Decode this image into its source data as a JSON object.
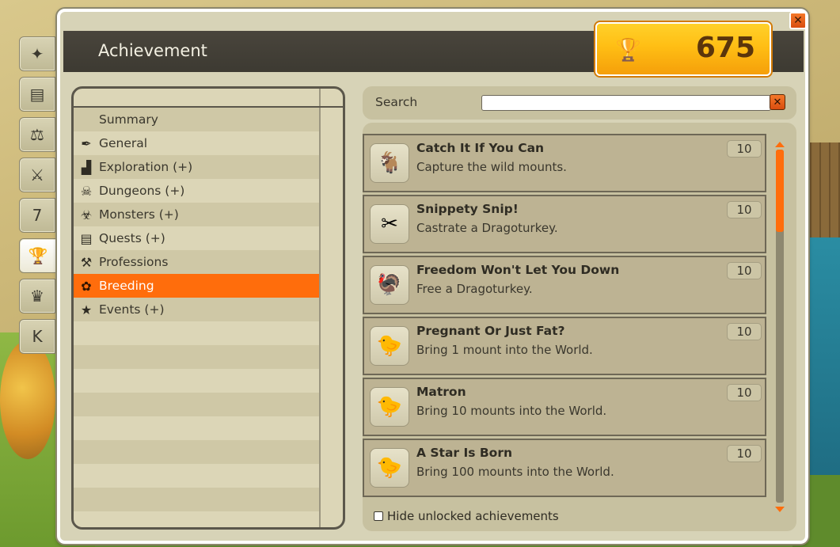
{
  "window": {
    "title": "Achievement",
    "close_label": "✕"
  },
  "score": {
    "value": "675",
    "icon": "trophy-icon"
  },
  "side_tabs": [
    {
      "icon": "wand-icon",
      "glyph": "✦"
    },
    {
      "icon": "book-icon",
      "glyph": "▤"
    },
    {
      "icon": "scales-icon",
      "glyph": "⚖"
    },
    {
      "icon": "crossed-weapons-icon",
      "glyph": "⚔"
    },
    {
      "icon": "calendar-icon",
      "glyph": "7"
    },
    {
      "icon": "trophy-icon",
      "glyph": "🏆",
      "active": true
    },
    {
      "icon": "crown-icon",
      "glyph": "♛"
    },
    {
      "icon": "k-icon",
      "glyph": "K"
    }
  ],
  "categories": [
    {
      "label": "Summary",
      "icon": "",
      "glyph": ""
    },
    {
      "label": "General",
      "icon": "quill-icon",
      "glyph": "✒"
    },
    {
      "label": "Exploration (+)",
      "icon": "boot-icon",
      "glyph": "▟"
    },
    {
      "label": "Dungeons (+)",
      "icon": "horned-skull-icon",
      "glyph": "☠"
    },
    {
      "label": "Monsters (+)",
      "icon": "monster-icon",
      "glyph": "☣"
    },
    {
      "label": "Quests (+)",
      "icon": "scroll-icon",
      "glyph": "▤"
    },
    {
      "label": "Professions",
      "icon": "hammer-icon",
      "glyph": "⚒"
    },
    {
      "label": "Breeding",
      "icon": "paw-icon",
      "glyph": "✿",
      "active": true
    },
    {
      "label": "Events (+)",
      "icon": "star-icon",
      "glyph": "★"
    }
  ],
  "search": {
    "label": "Search",
    "value": "",
    "clear_label": "✕"
  },
  "achievements": [
    {
      "name": "Catch It If You Can",
      "desc": "Capture the wild mounts.",
      "points": "10",
      "icon": "dragoturkey-capture-icon",
      "glyph": "🐐"
    },
    {
      "name": "Snippety Snip!",
      "desc": "Castrate a Dragoturkey.",
      "points": "10",
      "icon": "scissors-icon",
      "glyph": "✂"
    },
    {
      "name": "Freedom Won't Let You Down",
      "desc": "Free a Dragoturkey.",
      "points": "10",
      "icon": "freed-dragoturkey-icon",
      "glyph": "🦃"
    },
    {
      "name": "Pregnant Or Just Fat?",
      "desc": "Bring 1 mount into the World.",
      "points": "10",
      "icon": "baby-mount-icon",
      "glyph": "🐤"
    },
    {
      "name": "Matron",
      "desc": "Bring 10 mounts into the World.",
      "points": "10",
      "icon": "baby-mount-10-icon",
      "glyph": "🐤"
    },
    {
      "name": "A Star Is Born",
      "desc": "Bring 100 mounts into the World.",
      "points": "10",
      "icon": "baby-mount-100-icon",
      "glyph": "🐤"
    }
  ],
  "footer": {
    "hide_unlocked_label": "Hide unlocked achievements",
    "hide_unlocked_checked": false
  },
  "colors": {
    "accent": "#ff6d0c",
    "title_bar": "#433f36",
    "panel": "#d7d3b7"
  }
}
